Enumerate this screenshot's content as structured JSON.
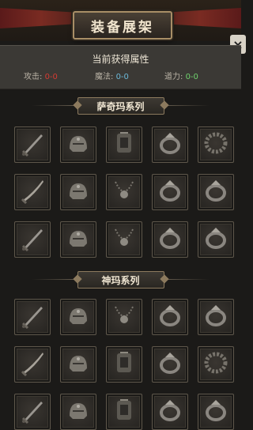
{
  "header": {
    "title": "装备展架",
    "close_label": "×"
  },
  "attributes": {
    "title": "当前获得属性",
    "items": [
      {
        "label": "攻击:",
        "value": "0-0",
        "color": "#d43b33"
      },
      {
        "label": "魔法:",
        "value": "0-0",
        "color": "#6bb8d8"
      },
      {
        "label": "道力:",
        "value": "0-0",
        "color": "#6fd06d"
      }
    ]
  },
  "sections": [
    {
      "name": "萨奇玛系列",
      "items": [
        "sword-icon",
        "helmet-icon",
        "armor-icon",
        "ring-icon",
        "bracelet-icon",
        "blade-icon",
        "helmet-icon",
        "necklace-icon",
        "ring-icon",
        "ring-icon",
        "sword-icon",
        "helmet-icon",
        "necklace-icon",
        "ring-icon",
        "ring-icon"
      ]
    },
    {
      "name": "神玛系列",
      "items": [
        "sword-icon",
        "helmet-icon",
        "necklace-icon",
        "ring-icon",
        "ring-icon",
        "blade-icon",
        "helmet-icon",
        "armor-icon",
        "ring-icon",
        "bracelet-icon",
        "sword-icon",
        "helmet-icon",
        "armor-icon",
        "ring-icon",
        "ring-icon"
      ]
    }
  ]
}
